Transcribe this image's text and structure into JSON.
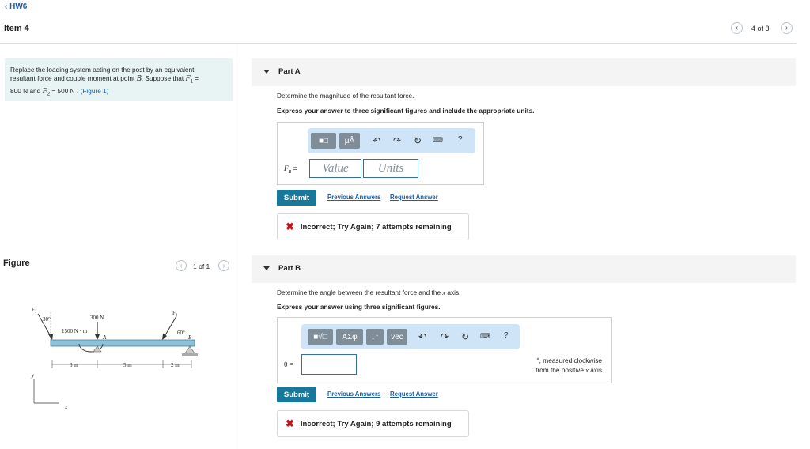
{
  "header": {
    "back_label": "HW6",
    "item_title": "Item 4",
    "pager": "4 of 8"
  },
  "problem": {
    "line1": "Replace the loading system acting on the post by an equivalent",
    "line2_a": "resultant force and couple moment at point ",
    "point": "B",
    "line2_b": ". Suppose that ",
    "f1_sym": "F",
    "f1_sub": "1",
    "eq1": " = ",
    "f1_val": "800  N",
    "and": " and ",
    "f2_sym": "F",
    "f2_sub": "2",
    "eq2": " = 500  N",
    "dot": " . ",
    "fig_link": "(Figure 1)"
  },
  "figure": {
    "label": "Figure",
    "pager": "1 of 1",
    "labels": {
      "f1": "F",
      "f1sub": "1",
      "f2": "F",
      "f2sub": "2",
      "ang1": "30°",
      "ang2": "60°",
      "load": "300 N",
      "moment": "1500 N · m",
      "A": "A",
      "B": "B",
      "d1": "3 m",
      "d2": "5 m",
      "d3": "2 m",
      "y": "y",
      "x": "x"
    }
  },
  "partA": {
    "title": "Part A",
    "question": "Determine the magnitude of the resultant force.",
    "instruction": "Express your answer to three significant figures and include the appropriate units.",
    "var_label": "F",
    "var_sub": "R",
    "var_eq": " =",
    "value_placeholder": "Value",
    "units_placeholder": "Units",
    "submit": "Submit",
    "prev": "Previous Answers",
    "request": "Request Answer",
    "feedback": "Incorrect; Try Again; 7 attempts remaining",
    "tb_mu": "μÅ",
    "tb_help": "?"
  },
  "partB": {
    "title": "Part B",
    "question_a": "Determine the angle between the resultant force and the ",
    "question_x": "x",
    "question_b": " axis.",
    "instruction": "Express your answer using three significant figures.",
    "var_label": "θ =",
    "unit_line1": "°, measured clockwise",
    "unit_line2_a": "from the positive ",
    "unit_x": "x",
    "unit_line2_b": " axis",
    "submit": "Submit",
    "prev": "Previous Answers",
    "request": "Request Answer",
    "feedback": "Incorrect; Try Again; 9 attempts remaining",
    "tb_greek": "ΑΣφ",
    "tb_sort": "↓↑",
    "tb_vec": "vec",
    "tb_help": "?"
  }
}
